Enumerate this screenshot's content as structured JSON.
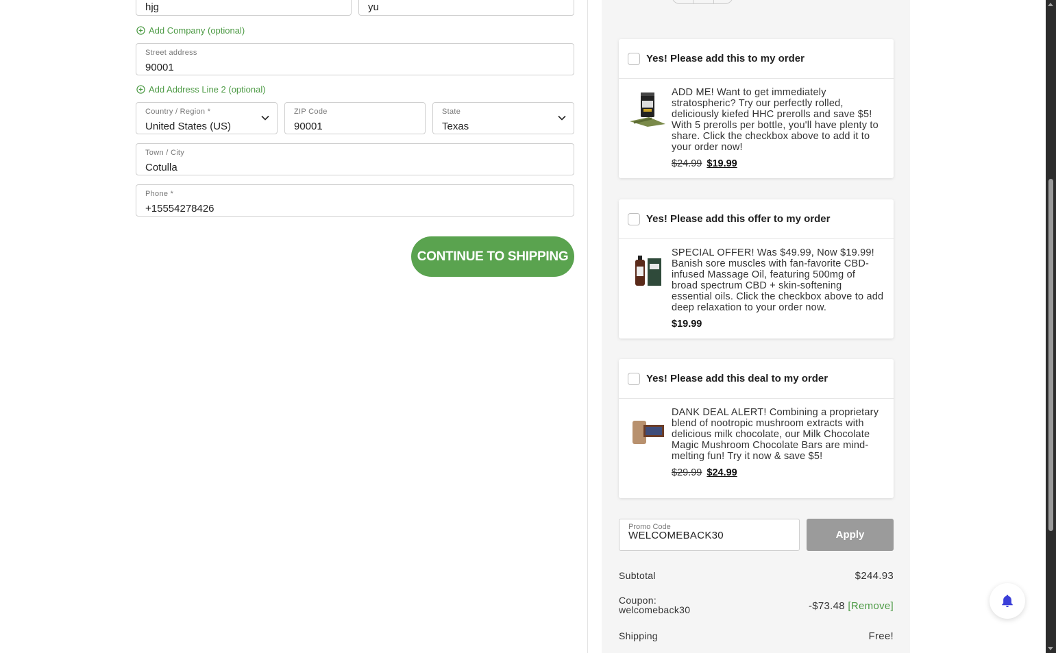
{
  "form": {
    "first_name": "hjg",
    "last_name": "yu",
    "add_company": "Add Company (optional)",
    "street": {
      "label": "Street address",
      "value": "90001"
    },
    "add_address2": "Add Address Line 2 (optional)",
    "country": {
      "label": "Country / Region *",
      "value": "United States (US)"
    },
    "zip": {
      "label": "ZIP Code",
      "value": "90001"
    },
    "state": {
      "label": "State",
      "value": "Texas"
    },
    "city": {
      "label": "Town / City",
      "value": "Cotulla"
    },
    "phone": {
      "label": "Phone *",
      "value": "+15554278426"
    },
    "continue_label": "CONTINUE TO SHIPPING"
  },
  "offers": [
    {
      "title": "Yes! Please add this to my order",
      "description": "ADD ME! Want to get immediately stratospheric? Try our perfectly rolled, deliciously kiefed HHC prerolls and save $5! With 5 prerolls per bottle, you'll have plenty to share. Click the checkbox above to add it to your order now!",
      "old_price": "$24.99",
      "new_price": "$19.99",
      "image": "preroll-bottle-product"
    },
    {
      "title": "Yes! Please add this offer to my order",
      "description": "SPECIAL OFFER! Was $49.99, Now $19.99! Banish sore muscles with fan-favorite CBD-infused Massage Oil, featuring 500mg of broad spectrum CBD + skin-softening essential oils. Click the checkbox above to add deep relaxation to your order now.",
      "price": "$19.99",
      "image": "massage-oil-product"
    },
    {
      "title": "Yes! Please add this deal to my order",
      "description": "DANK DEAL ALERT! Combining a proprietary blend of nootropic mushroom extracts with delicious milk chocolate, our Milk Chocolate Magic Mushroom Chocolate Bars are mind-melting fun! Try it now & save $5!",
      "old_price": "$29.99",
      "new_price": "$24.99",
      "image": "chocolate-bar-product"
    }
  ],
  "promo": {
    "label": "Promo Code",
    "value": "WELCOMEBACK30",
    "apply_label": "Apply"
  },
  "totals": {
    "subtotal_label": "Subtotal",
    "subtotal_value": "$244.93",
    "coupon_label_1": "Coupon:",
    "coupon_label_2": "welcomeback30",
    "coupon_value": "-$73.48",
    "remove_label": "[Remove]",
    "shipping_label": "Shipping",
    "shipping_value": "Free!"
  },
  "colors": {
    "accent": "#5aa34f",
    "link": "#4c9a44",
    "apply_bg": "#9b9b9b",
    "bell": "#3b3fd8"
  },
  "icons": {
    "add": "plus-circle-icon",
    "dropdown": "chevron-down-icon",
    "notification": "bell-icon"
  }
}
